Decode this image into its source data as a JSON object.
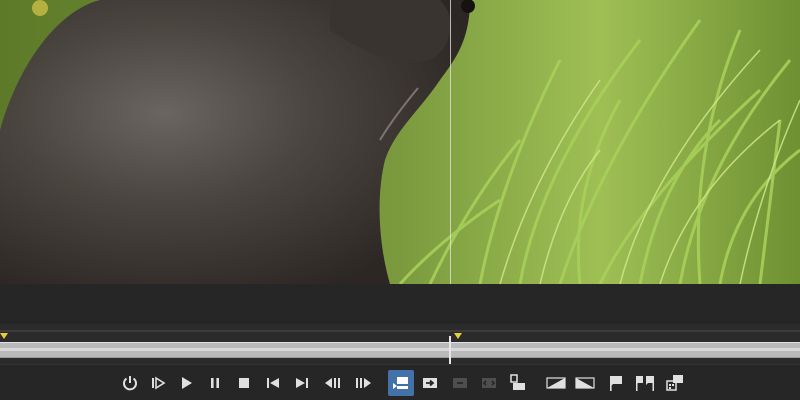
{
  "preview": {
    "frame": "marmot-in-grass",
    "split_compare": true
  },
  "timeline": {
    "playhead_fraction": 0.5625
  },
  "toolbar": {
    "buttons": [
      {
        "name": "power-icon",
        "interactable": true
      },
      {
        "name": "play-from-start-icon",
        "interactable": true
      },
      {
        "name": "play-icon",
        "interactable": true
      },
      {
        "name": "pause-icon",
        "interactable": true
      },
      {
        "name": "stop-icon",
        "interactable": true
      },
      {
        "name": "go-to-start-icon",
        "interactable": true
      },
      {
        "name": "go-to-end-icon",
        "interactable": true
      },
      {
        "name": "previous-frame-icon",
        "interactable": true
      },
      {
        "name": "next-frame-icon",
        "interactable": true
      },
      {
        "name": "insert-clip-icon",
        "interactable": true,
        "active": true
      },
      {
        "name": "overwrite-clip-icon",
        "interactable": true
      },
      {
        "name": "replace-clip-icon",
        "interactable": false,
        "disabled": true
      },
      {
        "name": "fit-to-fill-icon",
        "interactable": false,
        "disabled": true
      },
      {
        "name": "append-clip-icon",
        "interactable": true
      },
      {
        "name": "mark-in-icon",
        "interactable": true
      },
      {
        "name": "mark-out-icon",
        "interactable": true
      },
      {
        "name": "add-marker-icon",
        "interactable": true
      },
      {
        "name": "split-marker-icon",
        "interactable": true
      },
      {
        "name": "export-frame-icon",
        "interactable": true
      }
    ]
  },
  "colors": {
    "accent": "#4372a8",
    "marker": "#e7cf3a",
    "track": "#b9b9b9",
    "background": "#262626"
  }
}
